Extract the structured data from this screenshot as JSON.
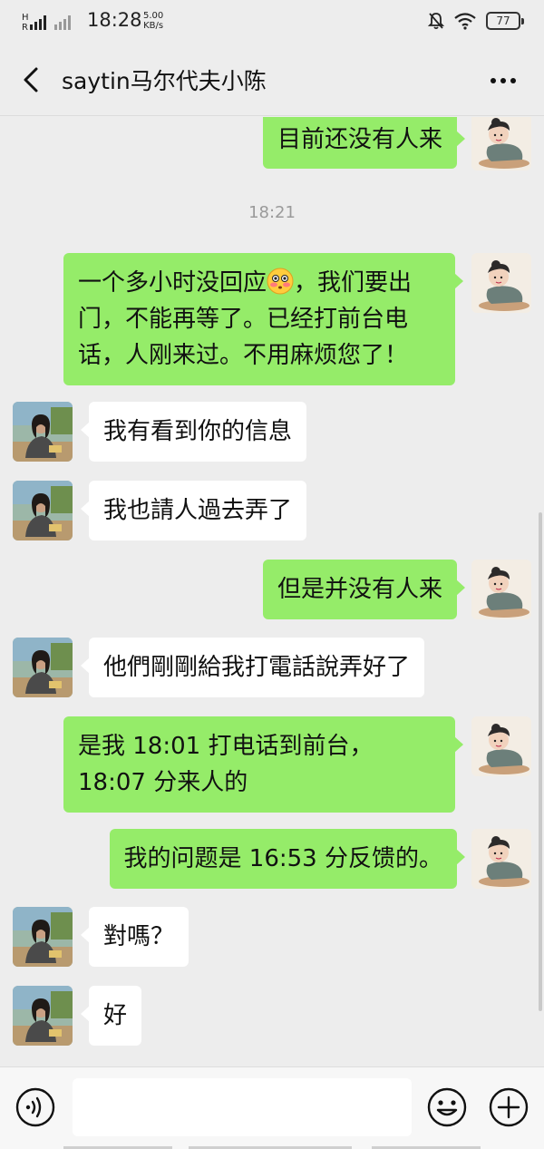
{
  "status_bar": {
    "time": "18:28",
    "speed_value": "5.00",
    "speed_unit": "KB/s",
    "battery": "77"
  },
  "nav": {
    "title": "saytin马尔代夫小陈",
    "back_icon": "chevron-left-icon",
    "more_icon": "more-dots-icon"
  },
  "chat": {
    "timestamp": "18:21",
    "messages": [
      {
        "side": "right",
        "text": "目前还没有人来"
      },
      {
        "side": "right",
        "text_before_emoji": "一个多小时没回应",
        "emoji": "flushed-face-emoji",
        "text_after_emoji": "，我们要出门，不能再等了。已经打前台电话，人刚来过。不用麻烦您了！"
      },
      {
        "side": "left",
        "text": "我有看到你的信息"
      },
      {
        "side": "left",
        "text": "我也請人過去弄了"
      },
      {
        "side": "right",
        "text": "但是并没有人来"
      },
      {
        "side": "left",
        "text": "他們剛剛給我打電話說弄好了"
      },
      {
        "side": "right",
        "text": "是我 18:01 打电话到前台，18:07 分来人的"
      },
      {
        "side": "right",
        "text": "我的问题是 16:53 分反馈的。"
      },
      {
        "side": "left",
        "text": "對嗎？"
      },
      {
        "side": "left",
        "text": "好"
      }
    ]
  },
  "input_bar": {
    "voice_icon": "voice-icon",
    "emoji_icon": "smiley-icon",
    "plus_icon": "plus-icon",
    "input_value": ""
  },
  "colors": {
    "background": "#ededed",
    "sent_bubble": "#95ec69",
    "received_bubble": "#ffffff"
  }
}
